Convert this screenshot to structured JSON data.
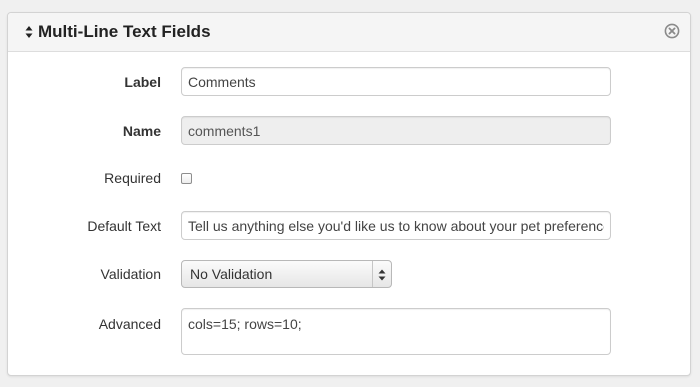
{
  "panel": {
    "title": "Multi-Line Text Fields",
    "icons": {
      "drag": "sort-arrows-icon",
      "close": "close-circle-icon"
    }
  },
  "form": {
    "label": {
      "label": "Label",
      "value": "Comments"
    },
    "name": {
      "label": "Name",
      "value": "comments1"
    },
    "required": {
      "label": "Required",
      "checked": false
    },
    "default_text": {
      "label": "Default Text",
      "value": "Tell us anything else you'd like us to know about your pet preferences"
    },
    "validation": {
      "label": "Validation",
      "selected": "No Validation"
    },
    "advanced": {
      "label": "Advanced",
      "value": "cols=15; rows=10;"
    }
  },
  "colors": {
    "panel_bg": "#ffffff",
    "header_bg": "#f5f5f5",
    "border": "#d3d3d3",
    "readonly_bg": "#eeeeee"
  }
}
